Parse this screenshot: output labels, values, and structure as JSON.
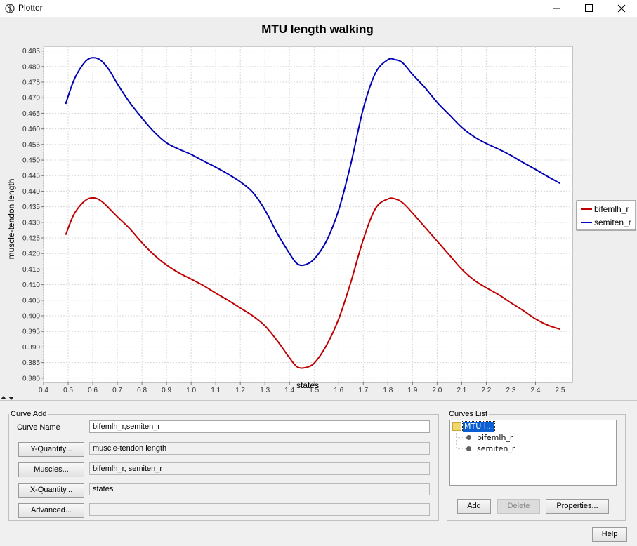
{
  "window": {
    "title": "Plotter"
  },
  "chart_data": {
    "type": "line",
    "title": "MTU length walking",
    "xlabel": "states",
    "ylabel": "muscle-tendon length",
    "xlim": [
      0.4,
      2.55
    ],
    "ylim": [
      0.3786,
      0.4865
    ],
    "xticks": [
      "0.4",
      "0.5",
      "0.6",
      "0.7",
      "0.8",
      "0.9",
      "1.0",
      "1.1",
      "1.2",
      "1.3",
      "1.4",
      "1.5",
      "1.6",
      "1.7",
      "1.8",
      "1.9",
      "2.0",
      "2.1",
      "2.2",
      "2.3",
      "2.4",
      "2.5"
    ],
    "yticks": [
      "0.380",
      "0.385",
      "0.390",
      "0.395",
      "0.400",
      "0.405",
      "0.410",
      "0.415",
      "0.420",
      "0.425",
      "0.430",
      "0.435",
      "0.440",
      "0.445",
      "0.450",
      "0.455",
      "0.460",
      "0.465",
      "0.470",
      "0.475",
      "0.480",
      "0.485"
    ],
    "grid": true,
    "legend_position": "right",
    "series": [
      {
        "name": "bifemlh_r",
        "color": "#c00000",
        "x": [
          0.49,
          0.52,
          0.55,
          0.58,
          0.61,
          0.64,
          0.67,
          0.7,
          0.75,
          0.8,
          0.85,
          0.9,
          0.95,
          1.0,
          1.05,
          1.1,
          1.15,
          1.2,
          1.25,
          1.3,
          1.35,
          1.4,
          1.43,
          1.46,
          1.5,
          1.55,
          1.6,
          1.65,
          1.7,
          1.75,
          1.8,
          1.83,
          1.86,
          1.9,
          1.95,
          2.0,
          2.05,
          2.1,
          2.15,
          2.2,
          2.25,
          2.3,
          2.35,
          2.4,
          2.45,
          2.5
        ],
        "y": [
          0.426,
          0.432,
          0.4355,
          0.4375,
          0.4378,
          0.4365,
          0.4342,
          0.4318,
          0.428,
          0.4235,
          0.4195,
          0.4163,
          0.4138,
          0.4118,
          0.4097,
          0.4073,
          0.405,
          0.4025,
          0.4,
          0.3968,
          0.392,
          0.3865,
          0.3837,
          0.3833,
          0.3848,
          0.3905,
          0.399,
          0.411,
          0.4245,
          0.4345,
          0.4375,
          0.4375,
          0.4363,
          0.433,
          0.4285,
          0.424,
          0.4195,
          0.415,
          0.4115,
          0.409,
          0.4068,
          0.4042,
          0.4017,
          0.399,
          0.397,
          0.3957
        ]
      },
      {
        "name": "semiten_r",
        "color": "#0000b4",
        "x": [
          0.49,
          0.52,
          0.55,
          0.58,
          0.61,
          0.64,
          0.67,
          0.7,
          0.75,
          0.8,
          0.85,
          0.9,
          0.95,
          1.0,
          1.05,
          1.1,
          1.15,
          1.2,
          1.25,
          1.3,
          1.35,
          1.4,
          1.43,
          1.46,
          1.5,
          1.55,
          1.6,
          1.65,
          1.7,
          1.75,
          1.8,
          1.83,
          1.86,
          1.9,
          1.95,
          2.0,
          2.05,
          2.1,
          2.15,
          2.2,
          2.25,
          2.3,
          2.35,
          2.4,
          2.45,
          2.5
        ],
        "y": [
          0.468,
          0.475,
          0.4795,
          0.4823,
          0.4828,
          0.4815,
          0.4785,
          0.4745,
          0.4685,
          0.4635,
          0.459,
          0.4555,
          0.4535,
          0.4518,
          0.4497,
          0.4477,
          0.4455,
          0.443,
          0.4397,
          0.434,
          0.4265,
          0.42,
          0.4168,
          0.4163,
          0.4182,
          0.424,
          0.434,
          0.449,
          0.4665,
          0.478,
          0.4822,
          0.4822,
          0.4812,
          0.4775,
          0.4733,
          0.4685,
          0.4645,
          0.4605,
          0.4575,
          0.4553,
          0.4535,
          0.4515,
          0.4492,
          0.447,
          0.4447,
          0.4425
        ]
      }
    ]
  },
  "curve_add": {
    "group_label": "Curve Add",
    "curve_name_label": "Curve Name",
    "curve_name_value": "bifemlh_r,semiten_r",
    "y_quantity_button": "Y-Quantity...",
    "y_quantity_value": "muscle-tendon length",
    "muscles_button": "Muscles...",
    "muscles_value": "bifemlh_r, semiten_r",
    "x_quantity_button": "X-Quantity...",
    "x_quantity_value": "states",
    "advanced_button": "Advanced...",
    "advanced_value": ""
  },
  "curves_list": {
    "group_label": "Curves List",
    "root_label": "MTU l...",
    "items": [
      "bifemlh_r",
      "semiten_r"
    ],
    "add_button": "Add",
    "delete_button": "Delete",
    "properties_button": "Properties..."
  },
  "help_button": "Help"
}
